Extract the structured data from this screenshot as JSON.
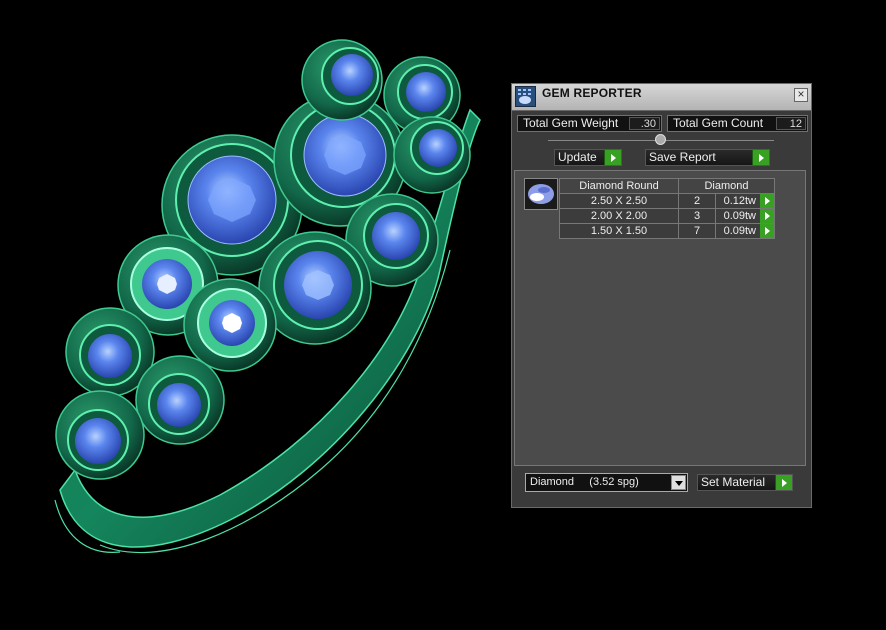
{
  "panel": {
    "title": "GEM REPORTER",
    "close_glyph": "×",
    "total_weight_label": "Total Gem Weight",
    "total_weight_value": ".30",
    "total_count_label": "Total Gem Count",
    "total_count_value": "12",
    "update_label": "Update",
    "save_report_label": "Save Report",
    "table_header_shape": "Diamond Round",
    "table_header_material": "Diamond",
    "rows": [
      {
        "size": "2.50 X 2.50",
        "count": "2",
        "weight": "0.12tw"
      },
      {
        "size": "2.00 X 2.00",
        "count": "3",
        "weight": "0.09tw"
      },
      {
        "size": "1.50 X 1.50",
        "count": "7",
        "weight": "0.09tw"
      }
    ],
    "material_select_value": "Diamond     (3.52 spg)",
    "set_material_label": "Set Material"
  },
  "colors": {
    "metal": "#1e8a5c",
    "metal_light": "#4fe0a5",
    "gem": "#4a73e0",
    "accent_button": "#38a022"
  },
  "icons": [
    "gem-reporter-app-icon",
    "close-icon",
    "arrow-right-icon",
    "chevron-down-icon",
    "gem-thumbnail-icon"
  ]
}
